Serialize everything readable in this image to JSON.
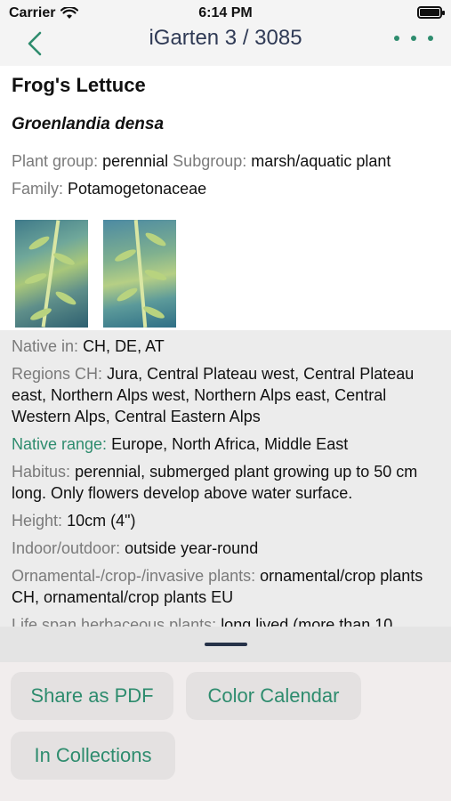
{
  "status_bar": {
    "carrier": "Carrier",
    "time": "6:14 PM"
  },
  "nav": {
    "title": "iGarten 3 / 3085"
  },
  "plant": {
    "name": "Frog's Lettuce",
    "latin": "Groenlandia densa",
    "plant_group_label": "Plant group:",
    "plant_group_value": "perennial",
    "subgroup_label": "Subgroup:",
    "subgroup_value": "marsh/aquatic plant",
    "family_label": "Family:",
    "family_value": "Potamogetonaceae"
  },
  "details": [
    {
      "label": "Native in:",
      "value": "CH, DE, AT"
    },
    {
      "label": "Regions CH:",
      "value": "Jura, Central Plateau west, Central Plateau east, Northern Alps west, Northern Alps east, Central Western Alps, Central Eastern Alps"
    },
    {
      "label": "Native range:",
      "value": "Europe, North Africa, Middle East"
    },
    {
      "label": "Habitus:",
      "value": "perennial, submerged plant growing up to 50 cm long. Only flowers develop above water surface."
    },
    {
      "label": "Height:",
      "value": "10cm (4\")"
    },
    {
      "label": "Indoor/outdoor:",
      "value": "outside year-round"
    },
    {
      "label": "Ornamental-/crop-/invasive plants:",
      "value": "ornamental/crop plants CH, ornamental/crop plants EU"
    },
    {
      "label": "Life span herbaceous plants:",
      "value": "long lived (more than 10"
    }
  ],
  "actions": {
    "share_pdf": "Share as PDF",
    "color_calendar": "Color Calendar",
    "in_collections": "In Collections"
  },
  "colors": {
    "accent": "#2e8c6e",
    "title": "#2f3a55"
  }
}
